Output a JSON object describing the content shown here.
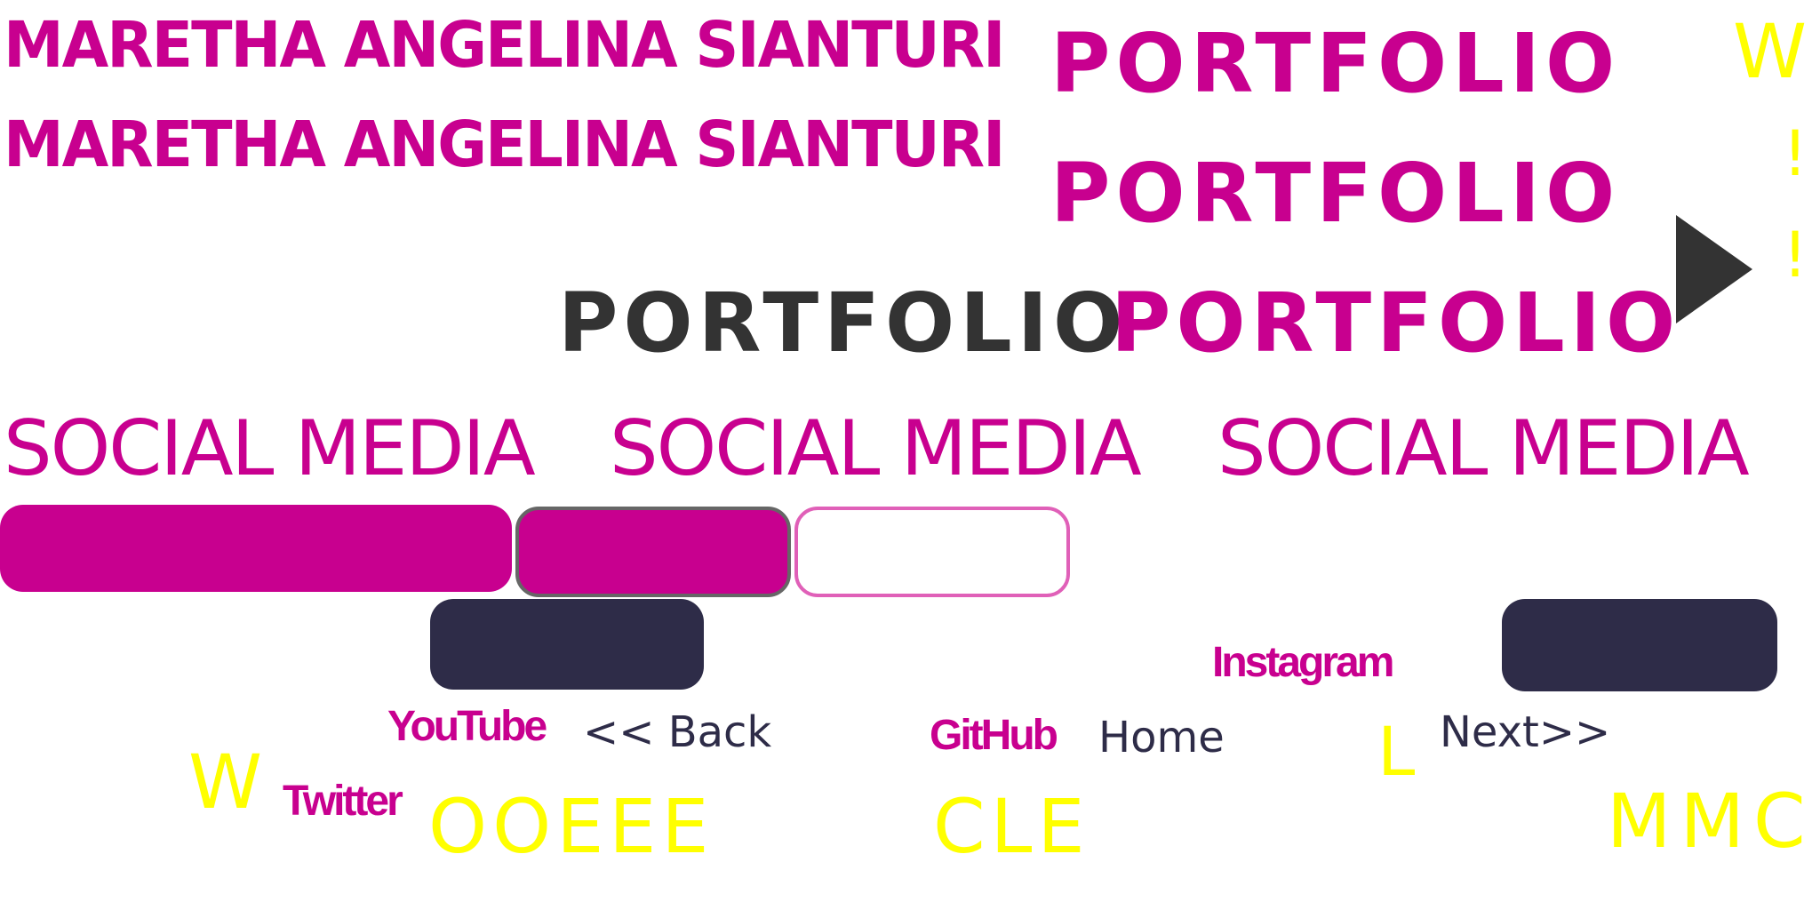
{
  "header": {
    "name_line_1": "MARETHA ANGELINA SIANTURI",
    "name_line_2": "MARETHA ANGELINA SIANTURI",
    "portfolio_1": "PORTFOLIO",
    "portfolio_2": "PORTFOLIO",
    "portfolio_dark": "PORTFOLIO",
    "portfolio_3": "PORTFOLIO"
  },
  "social_heading": {
    "text_1": "SOCIAL MEDIA",
    "text_2": "SOCIAL MEDIA",
    "text_3": "SOCIAL MEDIA"
  },
  "links": {
    "instagram": "Instagram",
    "youtube": "YouTube",
    "github": "GitHub",
    "twitter": "Twitter"
  },
  "nav": {
    "back": "<< Back",
    "home": "Home",
    "next": "Next>>"
  },
  "yellow_letters": {
    "top_w": "W",
    "excl_1": "!",
    "excl_2": "!",
    "w_bottom": "W",
    "l": "L",
    "ooeee": "OOEEE",
    "cle": "CLE",
    "mmc": "MMC"
  },
  "icons": {
    "play_arrow": "play-triangle-icon"
  },
  "colors": {
    "magenta": "#c8008f",
    "dark_navy": "#2e2c48",
    "dark_gray": "#333333",
    "yellow": "#ffff00",
    "outline_pink": "#e060b8"
  }
}
